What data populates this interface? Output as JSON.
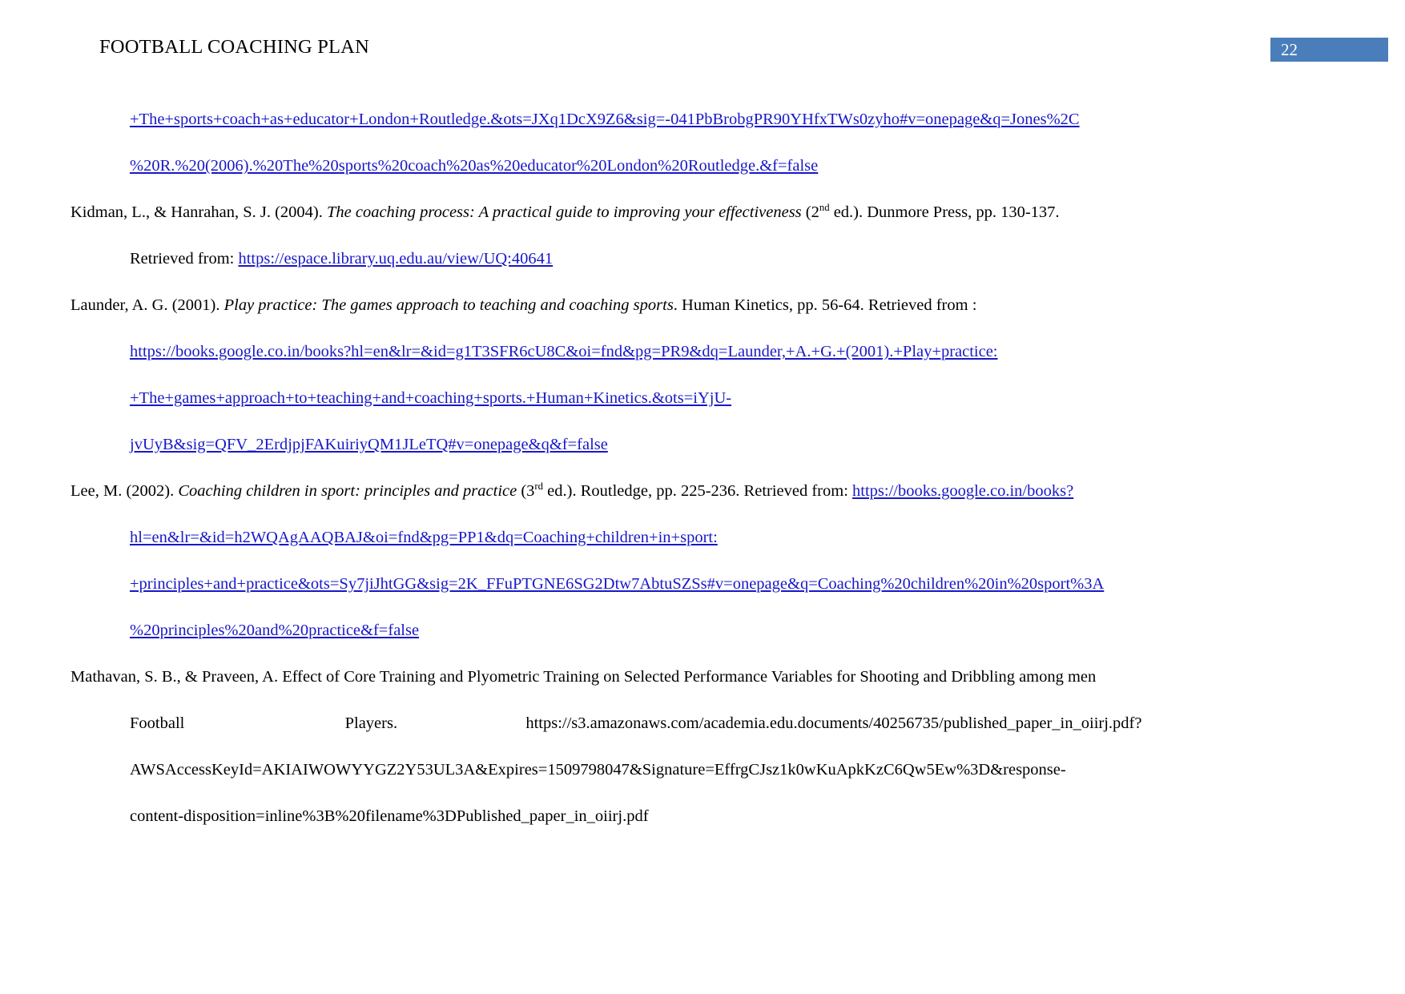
{
  "document": {
    "header_title": "FOOTBALL COACHING PLAN",
    "page_number": "22",
    "accent_color": "#4a7ebb",
    "link_color": "#1818c8",
    "text_color": "#000000",
    "background_color": "#ffffff"
  },
  "references": {
    "jones_continuation": {
      "line1": "+The+sports+coach+as+educator+London+Routledge.&ots=JXq1DcX9Z6&sig=-041PbBrobgPR90YHfxTWs0zyho#v=onepage&q=Jones%2C",
      "line2": "%20R.%20(2006).%20The%20sports%20coach%20as%20educator%20London%20Routledge.&f=false"
    },
    "kidman": {
      "authors_year": "Kidman, L., & Hanrahan, S. J. (2004).",
      "title_italic": "The coaching process: A practical guide to improving your effectiveness",
      "edition_prefix": "(2",
      "edition_sup": "nd",
      "edition_suffix": " ed.).",
      "publisher": "Dunmore Press, pp. 130-137.",
      "retrieved_label": "Retrieved from:",
      "url": "https://espace.library.uq.edu.au/view/UQ:40641"
    },
    "launder": {
      "authors_year": "Launder, A. G. (2001).",
      "title_italic": "Play practice: The games approach to teaching and coaching sports",
      "publisher": ". Human Kinetics, pp. 56-64. Retrieved from :",
      "url_line1": "https://books.google.co.in/books?hl=en&lr=&id=g1T3SFR6cU8C&oi=fnd&pg=PR9&dq=Launder,+A.+G.+(2001).+Play+practice:",
      "url_line2": "+The+games+approach+to+teaching+and+coaching+sports.+Human+Kinetics.&ots=iYjU-",
      "url_line3": "jvUyB&sig=QFV_2ErdjpjFAKuiriyQM1JLeTQ#v=onepage&q&f=false"
    },
    "lee": {
      "authors_year": "Lee, M. (2002).",
      "title_italic": "Coaching children in sport: principles and practice",
      "edition_prefix": "(3",
      "edition_sup": "rd",
      "edition_suffix": " ed.).",
      "publisher": "Routledge, pp. 225-236. Retrieved from:",
      "url_line1": "https://books.google.co.in/books?",
      "url_line2": "hl=en&lr=&id=h2WQAgAAQBAJ&oi=fnd&pg=PP1&dq=Coaching+children+in+sport:",
      "url_line3": "+principles+and+practice&ots=Sy7jiJhtGG&sig=2K_FFuPTGNE6SG2Dtw7AbtuSZSs#v=onepage&q=Coaching%20children%20in%20sport%3A",
      "url_line4": "%20principles%20and%20practice&f=false"
    },
    "mathavan": {
      "line1": "Mathavan, S. B., & Praveen, A. Effect of Core Training and Plyometric Training on Selected Performance Variables for Shooting and Dribbling among men",
      "line2_left": "Football",
      "line2_mid": "Players.",
      "line2_url": "https://s3.amazonaws.com/academia.edu.documents/40256735/published_paper_in_oiirj.pdf?",
      "line3": "AWSAccessKeyId=AKIAIWOWYYGZ2Y53UL3A&Expires=1509798047&Signature=EffrgCJsz1k0wKuApkKzC6Qw5Ew%3D&response-",
      "line4": "content-disposition=inline%3B%20filename%3DPublished_paper_in_oiirj.pdf"
    }
  }
}
